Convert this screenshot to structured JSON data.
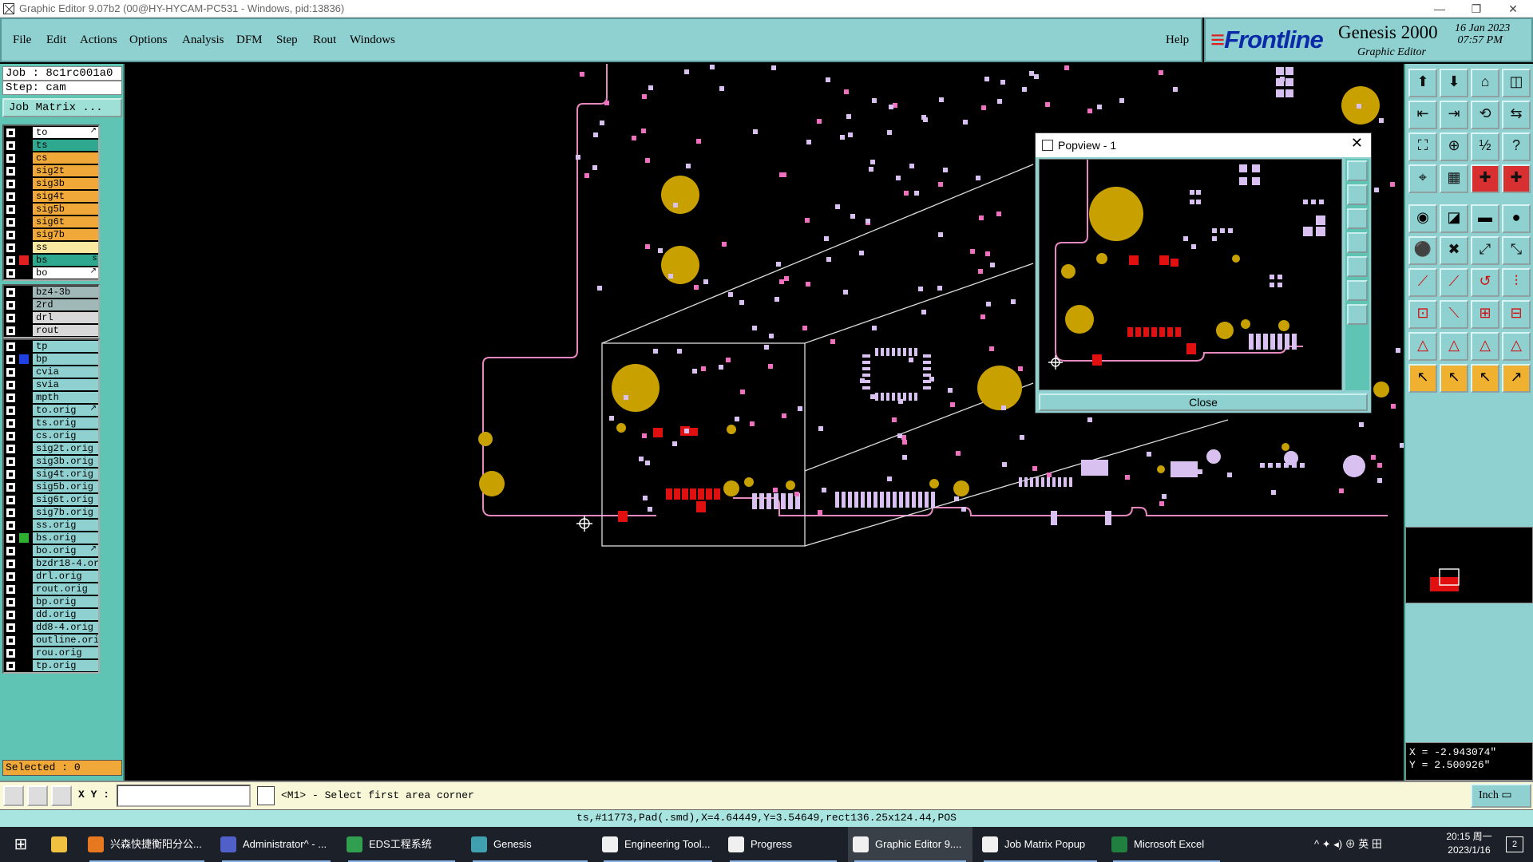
{
  "window": {
    "title": "Graphic Editor 9.07b2 (00@HY-HYCAM-PC531 - Windows, pid:13836)",
    "controls": [
      "—",
      "❐",
      "✕"
    ]
  },
  "menu": {
    "items": [
      "File",
      "Edit",
      "Actions",
      "Options",
      "Analysis",
      "DFM",
      "Step",
      "Rout",
      "Windows"
    ],
    "help": "Help"
  },
  "brand": {
    "logo": "Frontline",
    "product": "Genesis 2000",
    "subtitle": "Graphic Editor",
    "date": "16 Jan 2023",
    "time": "07:57 PM"
  },
  "job": {
    "job_label": "Job  : 8c1rc001a0",
    "step_label": "Step: cam",
    "matrix_button": "Job Matrix ..."
  },
  "layers_group1": [
    {
      "name": "to",
      "color": "#ffffff",
      "mark": "↗",
      "swatch": ""
    },
    {
      "name": "ts",
      "color": "#2fa890",
      "mark": "",
      "swatch": ""
    },
    {
      "name": "cs",
      "color": "#f0a838",
      "mark": "",
      "swatch": ""
    },
    {
      "name": "sig2t",
      "color": "#f0a838",
      "mark": "",
      "swatch": ""
    },
    {
      "name": "sig3b",
      "color": "#f0a838",
      "mark": "",
      "swatch": ""
    },
    {
      "name": "sig4t",
      "color": "#f0a838",
      "mark": "",
      "swatch": ""
    },
    {
      "name": "sig5b",
      "color": "#f0a838",
      "mark": "",
      "swatch": ""
    },
    {
      "name": "sig6t",
      "color": "#f0a838",
      "mark": "",
      "swatch": ""
    },
    {
      "name": "sig7b",
      "color": "#f0a838",
      "mark": "",
      "swatch": ""
    },
    {
      "name": "ss",
      "color": "#f8e8a0",
      "mark": "",
      "swatch": ""
    },
    {
      "name": "bs",
      "color": "#2fa890",
      "mark": "s",
      "swatch": "#e02020"
    },
    {
      "name": "bo",
      "color": "#ffffff",
      "mark": "↗",
      "swatch": ""
    }
  ],
  "layers_group2": [
    {
      "name": "bz4-3b",
      "color": "#a0b8b8",
      "mark": "",
      "swatch": ""
    },
    {
      "name": "2rd",
      "color": "#a0b8b8",
      "mark": "",
      "swatch": ""
    },
    {
      "name": "drl",
      "color": "#d8d8d8",
      "mark": "",
      "swatch": ""
    },
    {
      "name": "rout",
      "color": "#d8d8d8",
      "mark": "",
      "swatch": ""
    }
  ],
  "layers_group3": [
    {
      "name": "tp",
      "color": "#8fd0d0",
      "mark": "",
      "swatch": ""
    },
    {
      "name": "bp",
      "color": "#8fd0d0",
      "mark": "",
      "swatch": "#2040e0"
    },
    {
      "name": "cvia",
      "color": "#8fd0d0",
      "mark": "",
      "swatch": ""
    },
    {
      "name": "svia",
      "color": "#8fd0d0",
      "mark": "",
      "swatch": ""
    },
    {
      "name": "mpth",
      "color": "#8fd0d0",
      "mark": "",
      "swatch": ""
    },
    {
      "name": "to.orig",
      "color": "#8fd0d0",
      "mark": "↗",
      "swatch": ""
    },
    {
      "name": "ts.orig",
      "color": "#8fd0d0",
      "mark": "",
      "swatch": ""
    },
    {
      "name": "cs.orig",
      "color": "#8fd0d0",
      "mark": "",
      "swatch": ""
    },
    {
      "name": "sig2t.orig",
      "color": "#8fd0d0",
      "mark": "",
      "swatch": ""
    },
    {
      "name": "sig3b.orig",
      "color": "#8fd0d0",
      "mark": "",
      "swatch": ""
    },
    {
      "name": "sig4t.orig",
      "color": "#8fd0d0",
      "mark": "",
      "swatch": ""
    },
    {
      "name": "sig5b.orig",
      "color": "#8fd0d0",
      "mark": "",
      "swatch": ""
    },
    {
      "name": "sig6t.orig",
      "color": "#8fd0d0",
      "mark": "",
      "swatch": ""
    },
    {
      "name": "sig7b.orig",
      "color": "#8fd0d0",
      "mark": "",
      "swatch": ""
    },
    {
      "name": "ss.orig",
      "color": "#8fd0d0",
      "mark": "",
      "swatch": ""
    },
    {
      "name": "bs.orig",
      "color": "#8fd0d0",
      "mark": "",
      "swatch": "#30b030"
    },
    {
      "name": "bo.orig",
      "color": "#8fd0d0",
      "mark": "↗",
      "swatch": ""
    },
    {
      "name": "bzdr18-4.or",
      "color": "#8fd0d0",
      "mark": "",
      "swatch": ""
    },
    {
      "name": "drl.orig",
      "color": "#8fd0d0",
      "mark": "",
      "swatch": ""
    },
    {
      "name": "rout.orig",
      "color": "#8fd0d0",
      "mark": "",
      "swatch": ""
    },
    {
      "name": "bp.orig",
      "color": "#8fd0d0",
      "mark": "",
      "swatch": ""
    },
    {
      "name": "dd.orig",
      "color": "#8fd0d0",
      "mark": "",
      "swatch": ""
    },
    {
      "name": "dd8-4.orig",
      "color": "#8fd0d0",
      "mark": "",
      "swatch": ""
    },
    {
      "name": "outline.orig",
      "color": "#8fd0d0",
      "mark": "",
      "swatch": ""
    },
    {
      "name": "rou.orig",
      "color": "#8fd0d0",
      "mark": "",
      "swatch": ""
    },
    {
      "name": "tp.orig",
      "color": "#8fd0d0",
      "mark": "",
      "swatch": ""
    }
  ],
  "selected": "Selected : 0",
  "popview": {
    "title": "Popview - 1",
    "close_button": "Close"
  },
  "coords": {
    "x": "X = -2.943074\"",
    "y": "Y =  2.500926\""
  },
  "command": {
    "xy_label": "X Y :",
    "xy_value": "",
    "prompt": "<M1> - Select first area corner",
    "unit": "Inch"
  },
  "status": "ts,#11773,Pad(.smd),X=4.64449,Y=3.54649,rect136.25x124.44,POS",
  "colors": {
    "pad_yellow": "#c8a000",
    "pad_red": "#e01010",
    "pad_lilac": "#d8c0f0",
    "pad_pink": "#f070c0",
    "outline": "#e888c0"
  },
  "taskbar": {
    "items": [
      {
        "label": "兴森快捷衡阳分公...",
        "icon": "#e87820"
      },
      {
        "label": "Administrator^ - ...",
        "icon": "#5060c8"
      },
      {
        "label": "EDS工程系统",
        "icon": "#30a050"
      },
      {
        "label": "Genesis",
        "icon": "#40a0b0"
      },
      {
        "label": "Engineering Tool...",
        "icon": "#f0f0f0"
      },
      {
        "label": "Progress",
        "icon": "#f0f0f0"
      },
      {
        "label": "Graphic Editor 9....",
        "icon": "#f0f0f0"
      },
      {
        "label": "Job Matrix Popup",
        "icon": "#f0f0f0"
      },
      {
        "label": "Microsoft Excel",
        "icon": "#208040"
      }
    ],
    "tray": "^  ✦  ◂)  ⊕  英  田",
    "time": "20:15 周一",
    "date": "2023/1/16",
    "notif": "2"
  }
}
